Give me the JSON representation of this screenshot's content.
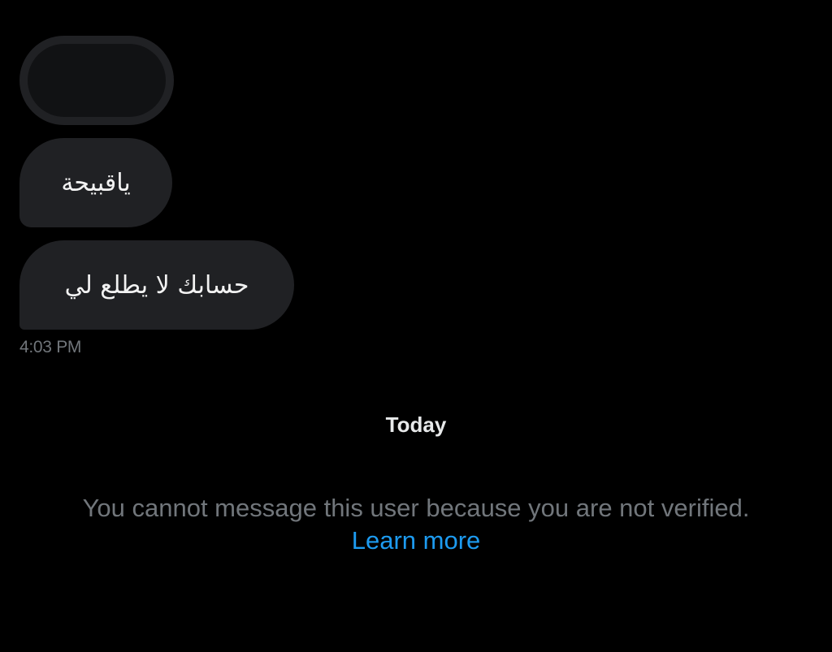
{
  "conversation": {
    "messages": [
      {
        "text": "",
        "redacted": true
      },
      {
        "text": "ياقبيحة"
      },
      {
        "text": "حسابك لا يطلع لي"
      }
    ],
    "last_timestamp": "4:03 PM",
    "day_separator": "Today"
  },
  "notice": {
    "message": "You cannot message this user because you are not verified.",
    "link_label": "Learn more"
  },
  "colors": {
    "background": "#000000",
    "bubble": "#202124",
    "muted_text": "#71767b",
    "link": "#1d9bf0"
  }
}
